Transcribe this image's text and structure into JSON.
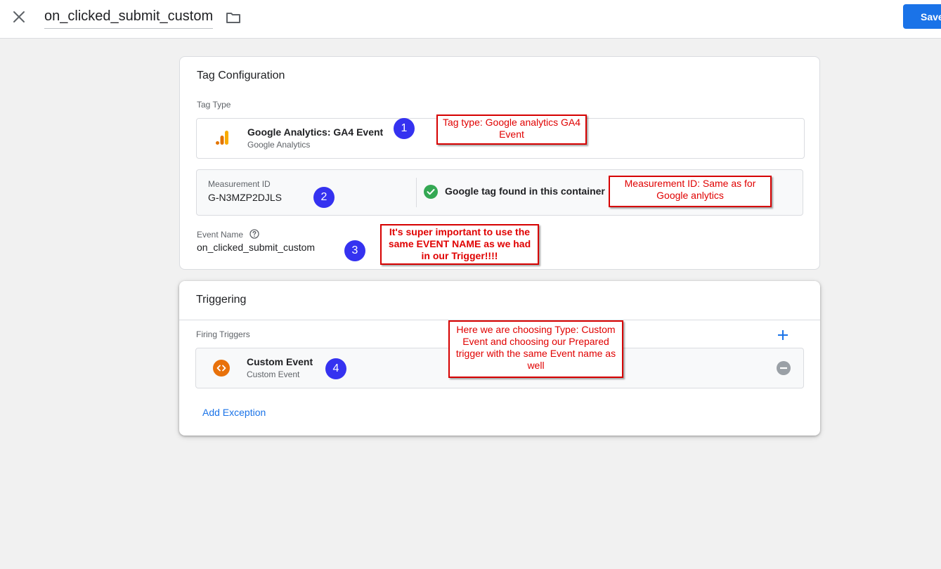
{
  "header": {
    "title": "on_clicked_submit_custom",
    "save_label": "Save"
  },
  "tag_config": {
    "card_title": "Tag Configuration",
    "tag_type_label": "Tag Type",
    "tag_type_name": "Google Analytics: GA4 Event",
    "tag_type_sub": "Google Analytics",
    "measurement_label": "Measurement ID",
    "measurement_value": "G-N3MZP2DJLS",
    "google_tag_status": "Google tag found in this container",
    "event_name_label": "Event Name",
    "event_name_value": "on_clicked_submit_custom"
  },
  "triggering": {
    "card_title": "Triggering",
    "firing_label": "Firing Triggers",
    "trigger_name": "Custom Event",
    "trigger_sub": "Custom Event",
    "add_exception": "Add Exception"
  },
  "annotations": {
    "badges": [
      "1",
      "2",
      "3",
      "4"
    ],
    "note1": "Tag type: Google analytics GA4 Event",
    "note2": "Measurement ID: Same as for Google anlytics",
    "note3": "It's super important to use the same EVENT NAME as we had in our Trigger!!!!",
    "note4": "Here we are choosing Type: Custom Event and choosing our Prepared trigger with the same Event name as well"
  },
  "colors": {
    "accent": "#1a73e8",
    "annotation_red": "#e00000",
    "badge_blue": "#3532f0",
    "check_green": "#34a853",
    "custom_event_orange": "#e8710a"
  },
  "icons": {
    "close": "close-icon",
    "folder": "folder-icon",
    "ga": "google-analytics-icon",
    "check": "check-circle-icon",
    "help": "help-icon",
    "custom_event": "custom-event-icon",
    "add": "plus-icon",
    "remove": "minus-circle-icon"
  }
}
